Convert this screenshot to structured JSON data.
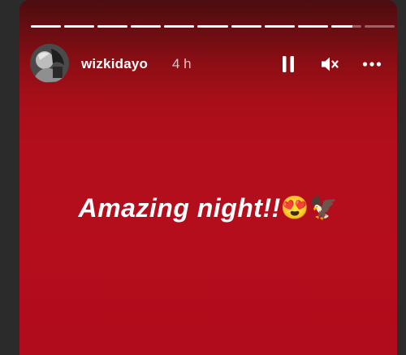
{
  "story": {
    "segments": [
      1,
      1,
      1,
      1,
      1,
      1,
      1,
      1,
      1,
      0.7,
      0
    ],
    "user": {
      "username": "wizkidayo",
      "time_ago": "4 h",
      "avatar_icon": "user-avatar"
    },
    "controls": {
      "pause_icon": "pause-icon",
      "mute_icon": "muted-speaker-icon",
      "more_icon": "more-horizontal-icon"
    },
    "caption": {
      "text": "Amazing night!!",
      "emojis": "😍🦅"
    },
    "colors": {
      "background": "#b50d1c",
      "text": "#ffffff"
    }
  }
}
